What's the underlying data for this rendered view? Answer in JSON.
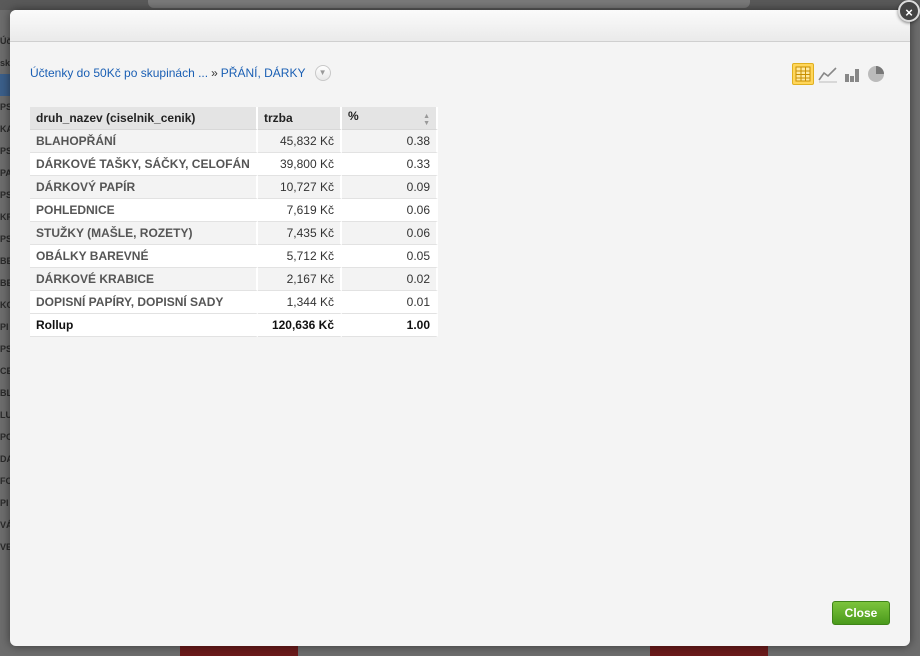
{
  "background": {
    "sidebar_fragments": [
      "Úč",
      "sk",
      "",
      "PS",
      "KA",
      "PS",
      "PA",
      "PS",
      "KF",
      "PS",
      "BE",
      "BE",
      "KO",
      "PI",
      "PS",
      "CE",
      "BL",
      "LU",
      "PC",
      "DA",
      "FO",
      "PI",
      "VÁ",
      "VE"
    ]
  },
  "modal": {
    "close_x": "×",
    "breadcrumb": {
      "parent": "Účtenky do 50Kč po skupinách ...",
      "separator": "»",
      "current": "PŘÁNÍ, DÁRKY",
      "dropdown_icon": "chevron-down-icon"
    },
    "view_icons": [
      {
        "name": "table-view-icon",
        "active": true
      },
      {
        "name": "line-chart-icon",
        "active": false
      },
      {
        "name": "bar-chart-icon",
        "active": false
      },
      {
        "name": "pie-chart-icon",
        "active": false
      }
    ],
    "table": {
      "headers": [
        "druh_nazev (ciselnik_cenik)",
        "trzba",
        "%"
      ],
      "rows": [
        {
          "name": "BLAHOPŘÁNÍ",
          "trzba": "45,832 Kč",
          "pct": "0.38"
        },
        {
          "name": "DÁRKOVÉ TAŠKY, SÁČKY, CELOFÁN",
          "trzba": "39,800 Kč",
          "pct": "0.33"
        },
        {
          "name": "DÁRKOVÝ PAPÍR",
          "trzba": "10,727 Kč",
          "pct": "0.09"
        },
        {
          "name": "POHLEDNICE",
          "trzba": "7,619 Kč",
          "pct": "0.06"
        },
        {
          "name": "STUŽKY (MAŠLE, ROZETY)",
          "trzba": "7,435 Kč",
          "pct": "0.06"
        },
        {
          "name": "OBÁLKY BAREVNÉ",
          "trzba": "5,712 Kč",
          "pct": "0.05"
        },
        {
          "name": "DÁRKOVÉ KRABICE",
          "trzba": "2,167 Kč",
          "pct": "0.02"
        },
        {
          "name": "DOPISNÍ PAPÍRY, DOPISNÍ SADY",
          "trzba": "1,344 Kč",
          "pct": "0.01"
        }
      ],
      "rollup": {
        "name": "Rollup",
        "trzba": "120,636 Kč",
        "pct": "1.00"
      }
    },
    "close_button": "Close",
    "colors": {
      "link": "#1a5fb4",
      "close_button": "#5aaa24",
      "active_view": "#ffd65a"
    }
  }
}
